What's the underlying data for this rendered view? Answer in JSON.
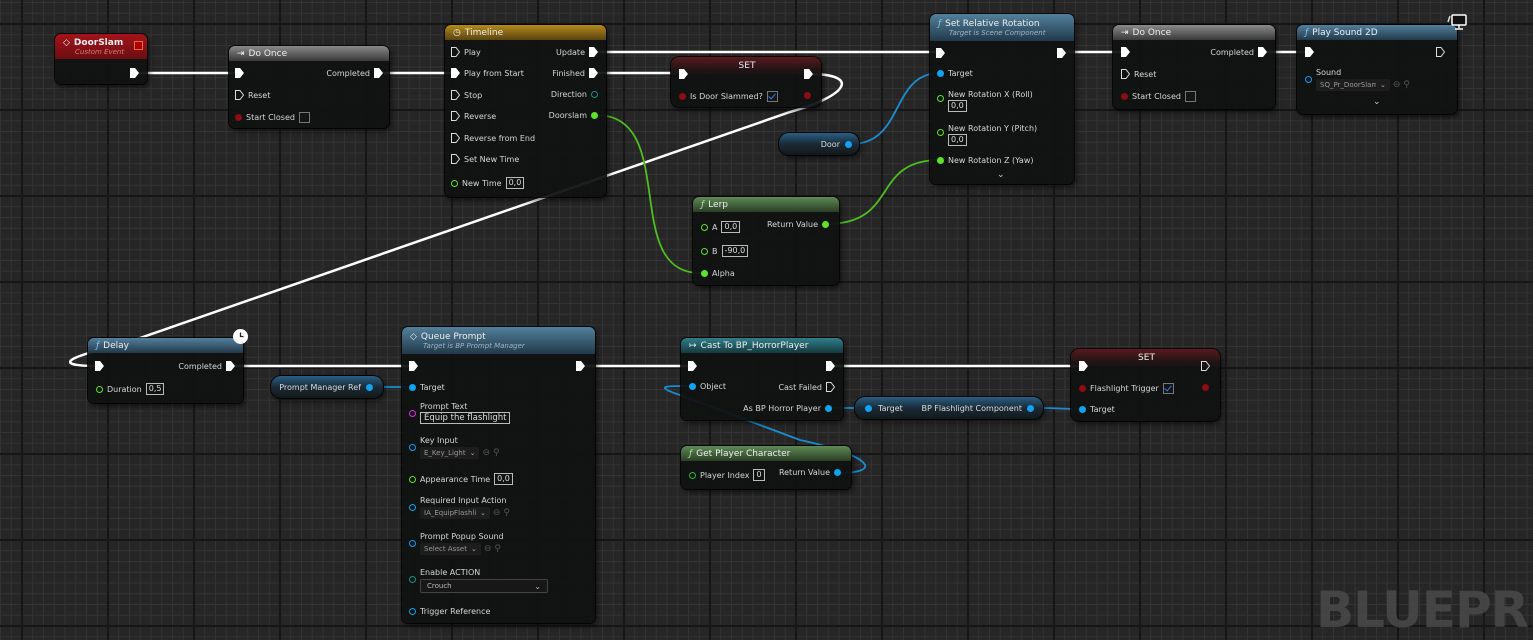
{
  "graph": {
    "watermark": "BLUEPRI",
    "corner_icon": "client-only-monitor-icon"
  },
  "nodes": {
    "door_slam_event": {
      "title": "DoorSlam",
      "subtitle": "Custom Event",
      "icon": "event-diamond-icon",
      "color": "#a3141a"
    },
    "do_once_1": {
      "title": "Do Once",
      "icon": "macro-arrow-icon",
      "pins": {
        "completed": "Completed",
        "reset": "Reset",
        "start_closed": "Start Closed"
      },
      "start_closed_checked": false
    },
    "timeline": {
      "title": "Timeline",
      "icon": "clock-icon",
      "inputs": [
        "Play",
        "Play from Start",
        "Stop",
        "Reverse",
        "Reverse from End",
        "Set New Time"
      ],
      "new_time_label": "New Time",
      "new_time_value": "0,0",
      "outputs": {
        "update": "Update",
        "finished": "Finished",
        "direction": "Direction",
        "track": "Doorslam"
      }
    },
    "set_door_slammed": {
      "title": "SET",
      "var_label": "Is Door Slammed?",
      "checked": true
    },
    "door_var": {
      "label": "Door"
    },
    "set_relative_rotation": {
      "title": "Set Relative Rotation",
      "subtitle": "Target is Scene Component",
      "target": "Target",
      "roll_label": "New Rotation X (Roll)",
      "roll_value": "0,0",
      "pitch_label": "New Rotation Y (Pitch)",
      "pitch_value": "0,0",
      "yaw_label": "New Rotation Z (Yaw)"
    },
    "lerp": {
      "title": "Lerp",
      "a_label": "A",
      "a_value": "0,0",
      "b_label": "B",
      "b_value": "-90,0",
      "alpha_label": "Alpha",
      "return_label": "Return Value"
    },
    "do_once_2": {
      "title": "Do Once",
      "pins": {
        "completed": "Completed",
        "reset": "Reset",
        "start_closed": "Start Closed"
      },
      "start_closed_checked": false
    },
    "play_sound_2d": {
      "title": "Play Sound 2D",
      "sound_label": "Sound",
      "sound_value": "SQ_Pr_DoorSlam"
    },
    "delay": {
      "title": "Delay",
      "completed": "Completed",
      "duration_label": "Duration",
      "duration_value": "0,5"
    },
    "prompt_manager_var": {
      "label": "Prompt Manager Ref"
    },
    "queue_prompt": {
      "title": "Queue Prompt",
      "subtitle": "Target is BP Prompt Manager",
      "target": "Target",
      "prompt_text_label": "Prompt Text",
      "prompt_text_value": "Equip the flashlight",
      "key_input_label": "Key Input",
      "key_input_value": "E_Key_Light",
      "appearance_time_label": "Appearance Time",
      "appearance_time_value": "0,0",
      "required_action_label": "Required Input Action",
      "required_action_value": "IA_EquipFlashlig",
      "popup_sound_label": "Prompt Popup Sound",
      "popup_sound_value": "Select Asset",
      "enable_action_label": "Enable ACTION",
      "enable_action_value": "Crouch",
      "trigger_ref_label": "Trigger Reference"
    },
    "cast_to_player": {
      "title": "Cast To BP_HorrorPlayer",
      "object": "Object",
      "cast_failed": "Cast Failed",
      "as_player": "As BP Horror Player"
    },
    "get_player_character": {
      "title": "Get Player Character",
      "index_label": "Player Index",
      "index_value": "0",
      "return_label": "Return Value"
    },
    "flashlight_component_getter": {
      "target": "Target",
      "output": "BP Flashlight Component"
    },
    "set_flashlight_trigger": {
      "title": "SET",
      "var_label": "Flashlight Trigger",
      "checked": true,
      "target": "Target"
    }
  },
  "colors": {
    "exec": "#ffffff",
    "object_pin": "#11a3ef",
    "float_pin": "#5ee22a",
    "bool_pin": "#8c0d12",
    "text_pin": "#e02be0",
    "byte_pin": "#1d8f82"
  }
}
